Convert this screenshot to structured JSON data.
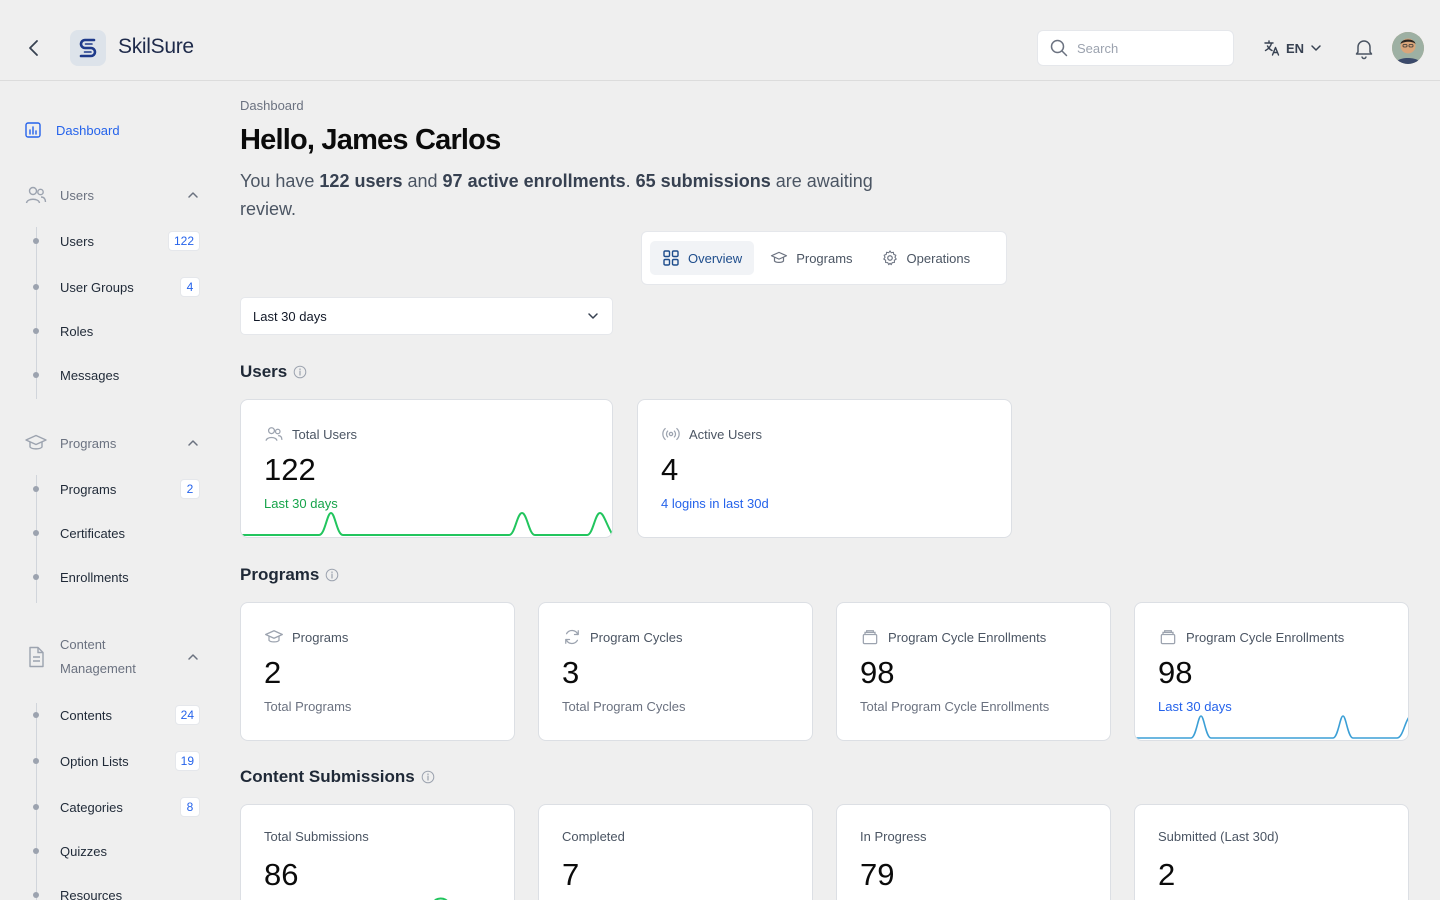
{
  "header": {
    "brand": "SkilSure",
    "search_placeholder": "Search",
    "language": "EN"
  },
  "sidebar": {
    "dashboard": "Dashboard",
    "groups": [
      {
        "label": "Users",
        "items": [
          {
            "label": "Users",
            "badge": "122"
          },
          {
            "label": "User Groups",
            "badge": "4"
          },
          {
            "label": "Roles",
            "badge": ""
          },
          {
            "label": "Messages",
            "badge": ""
          }
        ]
      },
      {
        "label": "Programs",
        "items": [
          {
            "label": "Programs",
            "badge": "2"
          },
          {
            "label": "Certificates",
            "badge": ""
          },
          {
            "label": "Enrollments",
            "badge": ""
          }
        ]
      },
      {
        "label_line1": "Content",
        "label_line2": "Management",
        "items": [
          {
            "label": "Contents",
            "badge": "24"
          },
          {
            "label": "Option Lists",
            "badge": "19"
          },
          {
            "label": "Categories",
            "badge": "8"
          },
          {
            "label": "Quizzes",
            "badge": ""
          },
          {
            "label": "Resources",
            "badge": ""
          }
        ]
      }
    ]
  },
  "main": {
    "breadcrumb": "Dashboard",
    "greeting": "Hello, James Carlos",
    "summary": {
      "p1": "You have ",
      "users": "122 users",
      "p2": " and ",
      "enrollments": "97 active enrollments",
      "p3": ". ",
      "submissions": "65 submissions",
      "p4": " are awaiting review."
    },
    "tabs": [
      {
        "label": "Overview",
        "active": true
      },
      {
        "label": "Programs",
        "active": false
      },
      {
        "label": "Operations",
        "active": false
      }
    ],
    "period_select": "Last 30 days",
    "sections": {
      "users": {
        "title": "Users",
        "cards": [
          {
            "title": "Total Users",
            "value": "122",
            "sub": "Last 30 days"
          },
          {
            "title": "Active Users",
            "value": "4",
            "sub": "4 logins in last 30d"
          }
        ]
      },
      "programs": {
        "title": "Programs",
        "cards": [
          {
            "title": "Programs",
            "value": "2",
            "sub": "Total Programs"
          },
          {
            "title": "Program Cycles",
            "value": "3",
            "sub": "Total Program Cycles"
          },
          {
            "title": "Program Cycle Enrollments",
            "value": "98",
            "sub": "Total Program Cycle Enrollments"
          },
          {
            "title": "Program Cycle Enrollments",
            "value": "98",
            "sub": "Last 30 days"
          }
        ]
      },
      "submissions": {
        "title": "Content Submissions",
        "cards": [
          {
            "title": "Total Submissions",
            "value": "86"
          },
          {
            "title": "Completed",
            "value": "7"
          },
          {
            "title": "In Progress",
            "value": "79"
          },
          {
            "title": "Submitted (Last 30d)",
            "value": "2"
          }
        ]
      }
    }
  },
  "colors": {
    "accent": "#2563eb",
    "spark_green": "#22c55e",
    "spark_blue": "#3b9fd6"
  }
}
